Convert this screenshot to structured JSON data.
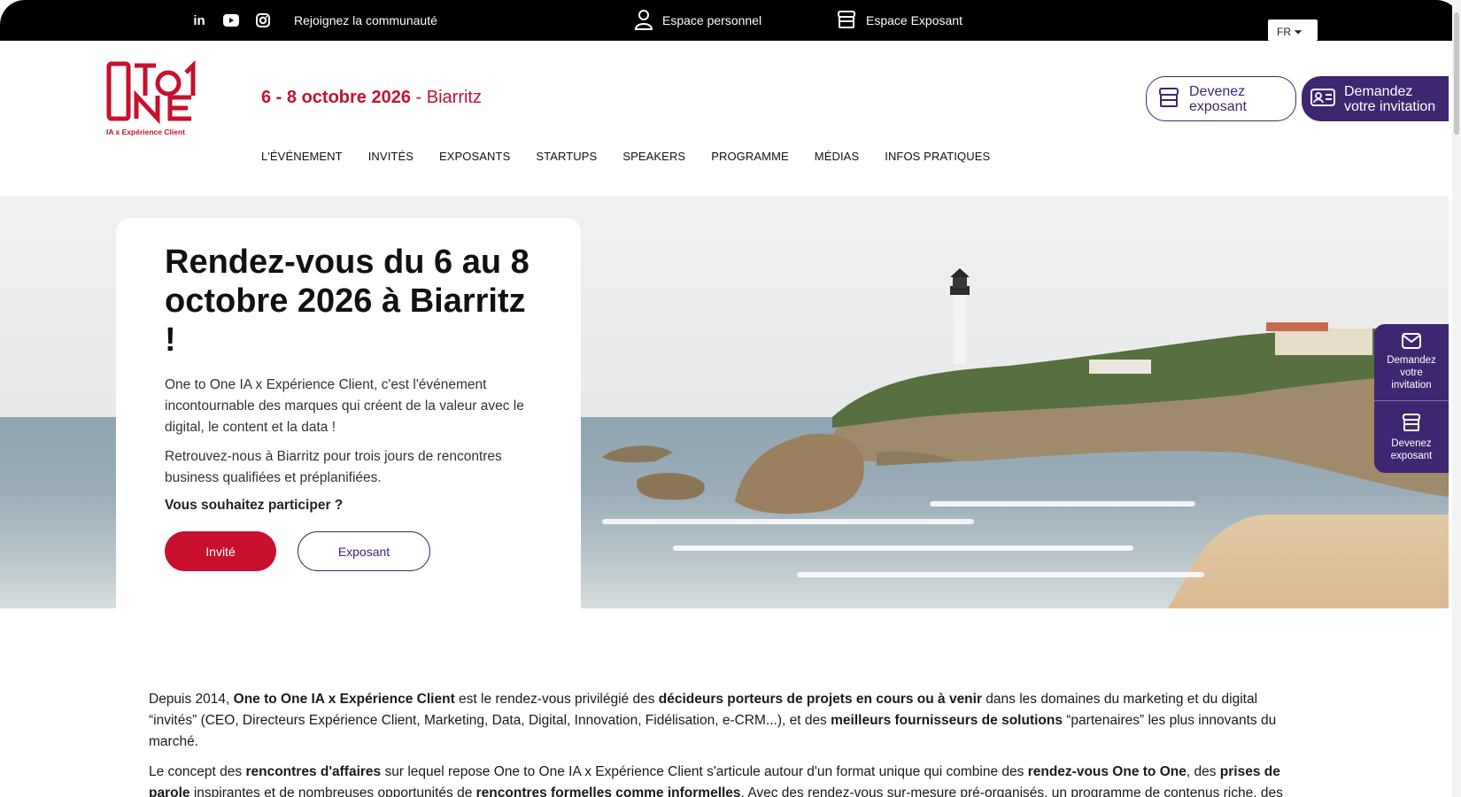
{
  "topbar": {
    "social_icons": [
      "linkedin-icon",
      "youtube-icon",
      "instagram-icon"
    ],
    "community": "Rejoignez la communauté",
    "personal_space": "Espace personnel",
    "exhibitor_space": "Espace Exposant",
    "lang": "FR"
  },
  "logo": {
    "tagline": "IA x Expérience Client"
  },
  "header": {
    "date": "6 - 8 octobre 2026",
    "city": "- Biarritz",
    "btn_exhibitor_1": "Devenez",
    "btn_exhibitor_2": "exposant",
    "btn_invite_1": "Demandez",
    "btn_invite_2": "votre invitation"
  },
  "nav": [
    "L'ÉVÉNEMENT",
    "INVITÉS",
    "EXPOSANTS",
    "STARTUPS",
    "SPEAKERS",
    "PROGRAMME",
    "MÉDIAS",
    "INFOS PRATIQUES"
  ],
  "hero": {
    "title": "Rendez-vous du 6 au 8 octobre 2026 à Biarritz !",
    "p1": "One to One IA x Expérience Client, c'est l'événement incontournable des marques qui créent de la valeur avec le digital, le content et la data !",
    "p2": "Retrouvez-nous à Biarritz pour trois jours de rencontres business qualifiées et préplanifiées.",
    "question": "Vous souhaitez participer ?",
    "btn_guest": "Invité",
    "btn_exhibitor": "Exposant"
  },
  "side_widget": {
    "invite": "Demandez votre invitation",
    "exhibitor": "Devenez exposant"
  },
  "intro": {
    "p1": [
      {
        "t": "Depuis 2014, ",
        "b": false
      },
      {
        "t": "One to One IA x Expérience Client",
        "b": true
      },
      {
        "t": " est le rendez-vous privilégié des ",
        "b": false
      },
      {
        "t": "décideurs porteurs de projets en cours ou à venir",
        "b": true
      },
      {
        "t": " dans les domaines du marketing et du digital “invités” (CEO, Directeurs Expérience Client, Marketing, Data, Digital, Innovation, Fidélisation, e-CRM...), et des ",
        "b": false
      },
      {
        "t": "meilleurs fournisseurs de solutions",
        "b": true
      },
      {
        "t": " “partenaires” les plus innovants du marché.",
        "b": false
      }
    ],
    "p2": [
      {
        "t": "Le concept des ",
        "b": false
      },
      {
        "t": "rencontres d'affaires",
        "b": true
      },
      {
        "t": " sur lequel repose One to One IA x Expérience Client s'articule autour d'un format unique qui combine des ",
        "b": false
      },
      {
        "t": "rendez-vous One to One",
        "b": true
      },
      {
        "t": ", des ",
        "b": false
      },
      {
        "t": "prises de parole",
        "b": true
      },
      {
        "t": " inspirantes et de nombreuses opportunités de ",
        "b": false
      },
      {
        "t": "rencontres formelles comme informelles",
        "b": true
      },
      {
        "t": ". Avec des rendez-vous sur-mesure pré-organisés, un programme de contenus riche, des",
        "b": false
      }
    ]
  },
  "colors": {
    "brand_red": "#c8102e",
    "brand_purple": "#3f2670"
  }
}
